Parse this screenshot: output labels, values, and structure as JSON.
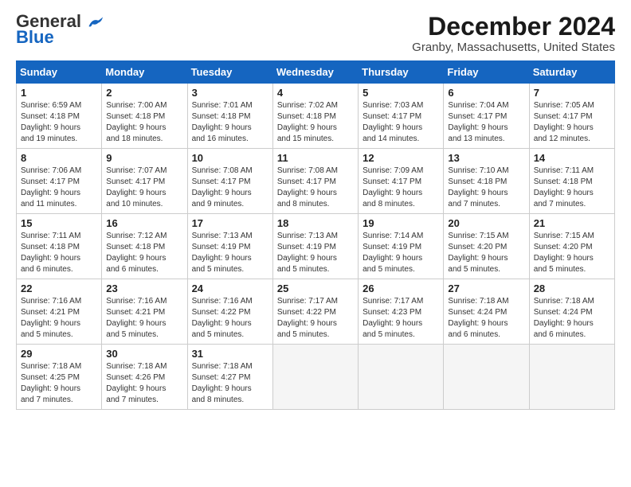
{
  "header": {
    "logo_general": "General",
    "logo_blue": "Blue",
    "month_title": "December 2024",
    "location": "Granby, Massachusetts, United States"
  },
  "weekdays": [
    "Sunday",
    "Monday",
    "Tuesday",
    "Wednesday",
    "Thursday",
    "Friday",
    "Saturday"
  ],
  "weeks": [
    [
      {
        "day": "1",
        "info": "Sunrise: 6:59 AM\nSunset: 4:18 PM\nDaylight: 9 hours\nand 19 minutes."
      },
      {
        "day": "2",
        "info": "Sunrise: 7:00 AM\nSunset: 4:18 PM\nDaylight: 9 hours\nand 18 minutes."
      },
      {
        "day": "3",
        "info": "Sunrise: 7:01 AM\nSunset: 4:18 PM\nDaylight: 9 hours\nand 16 minutes."
      },
      {
        "day": "4",
        "info": "Sunrise: 7:02 AM\nSunset: 4:18 PM\nDaylight: 9 hours\nand 15 minutes."
      },
      {
        "day": "5",
        "info": "Sunrise: 7:03 AM\nSunset: 4:17 PM\nDaylight: 9 hours\nand 14 minutes."
      },
      {
        "day": "6",
        "info": "Sunrise: 7:04 AM\nSunset: 4:17 PM\nDaylight: 9 hours\nand 13 minutes."
      },
      {
        "day": "7",
        "info": "Sunrise: 7:05 AM\nSunset: 4:17 PM\nDaylight: 9 hours\nand 12 minutes."
      }
    ],
    [
      {
        "day": "8",
        "info": "Sunrise: 7:06 AM\nSunset: 4:17 PM\nDaylight: 9 hours\nand 11 minutes."
      },
      {
        "day": "9",
        "info": "Sunrise: 7:07 AM\nSunset: 4:17 PM\nDaylight: 9 hours\nand 10 minutes."
      },
      {
        "day": "10",
        "info": "Sunrise: 7:08 AM\nSunset: 4:17 PM\nDaylight: 9 hours\nand 9 minutes."
      },
      {
        "day": "11",
        "info": "Sunrise: 7:08 AM\nSunset: 4:17 PM\nDaylight: 9 hours\nand 8 minutes."
      },
      {
        "day": "12",
        "info": "Sunrise: 7:09 AM\nSunset: 4:17 PM\nDaylight: 9 hours\nand 8 minutes."
      },
      {
        "day": "13",
        "info": "Sunrise: 7:10 AM\nSunset: 4:18 PM\nDaylight: 9 hours\nand 7 minutes."
      },
      {
        "day": "14",
        "info": "Sunrise: 7:11 AM\nSunset: 4:18 PM\nDaylight: 9 hours\nand 7 minutes."
      }
    ],
    [
      {
        "day": "15",
        "info": "Sunrise: 7:11 AM\nSunset: 4:18 PM\nDaylight: 9 hours\nand 6 minutes."
      },
      {
        "day": "16",
        "info": "Sunrise: 7:12 AM\nSunset: 4:18 PM\nDaylight: 9 hours\nand 6 minutes."
      },
      {
        "day": "17",
        "info": "Sunrise: 7:13 AM\nSunset: 4:19 PM\nDaylight: 9 hours\nand 5 minutes."
      },
      {
        "day": "18",
        "info": "Sunrise: 7:13 AM\nSunset: 4:19 PM\nDaylight: 9 hours\nand 5 minutes."
      },
      {
        "day": "19",
        "info": "Sunrise: 7:14 AM\nSunset: 4:19 PM\nDaylight: 9 hours\nand 5 minutes."
      },
      {
        "day": "20",
        "info": "Sunrise: 7:15 AM\nSunset: 4:20 PM\nDaylight: 9 hours\nand 5 minutes."
      },
      {
        "day": "21",
        "info": "Sunrise: 7:15 AM\nSunset: 4:20 PM\nDaylight: 9 hours\nand 5 minutes."
      }
    ],
    [
      {
        "day": "22",
        "info": "Sunrise: 7:16 AM\nSunset: 4:21 PM\nDaylight: 9 hours\nand 5 minutes."
      },
      {
        "day": "23",
        "info": "Sunrise: 7:16 AM\nSunset: 4:21 PM\nDaylight: 9 hours\nand 5 minutes."
      },
      {
        "day": "24",
        "info": "Sunrise: 7:16 AM\nSunset: 4:22 PM\nDaylight: 9 hours\nand 5 minutes."
      },
      {
        "day": "25",
        "info": "Sunrise: 7:17 AM\nSunset: 4:22 PM\nDaylight: 9 hours\nand 5 minutes."
      },
      {
        "day": "26",
        "info": "Sunrise: 7:17 AM\nSunset: 4:23 PM\nDaylight: 9 hours\nand 5 minutes."
      },
      {
        "day": "27",
        "info": "Sunrise: 7:18 AM\nSunset: 4:24 PM\nDaylight: 9 hours\nand 6 minutes."
      },
      {
        "day": "28",
        "info": "Sunrise: 7:18 AM\nSunset: 4:24 PM\nDaylight: 9 hours\nand 6 minutes."
      }
    ],
    [
      {
        "day": "29",
        "info": "Sunrise: 7:18 AM\nSunset: 4:25 PM\nDaylight: 9 hours\nand 7 minutes."
      },
      {
        "day": "30",
        "info": "Sunrise: 7:18 AM\nSunset: 4:26 PM\nDaylight: 9 hours\nand 7 minutes."
      },
      {
        "day": "31",
        "info": "Sunrise: 7:18 AM\nSunset: 4:27 PM\nDaylight: 9 hours\nand 8 minutes."
      },
      {
        "day": "",
        "info": ""
      },
      {
        "day": "",
        "info": ""
      },
      {
        "day": "",
        "info": ""
      },
      {
        "day": "",
        "info": ""
      }
    ]
  ]
}
